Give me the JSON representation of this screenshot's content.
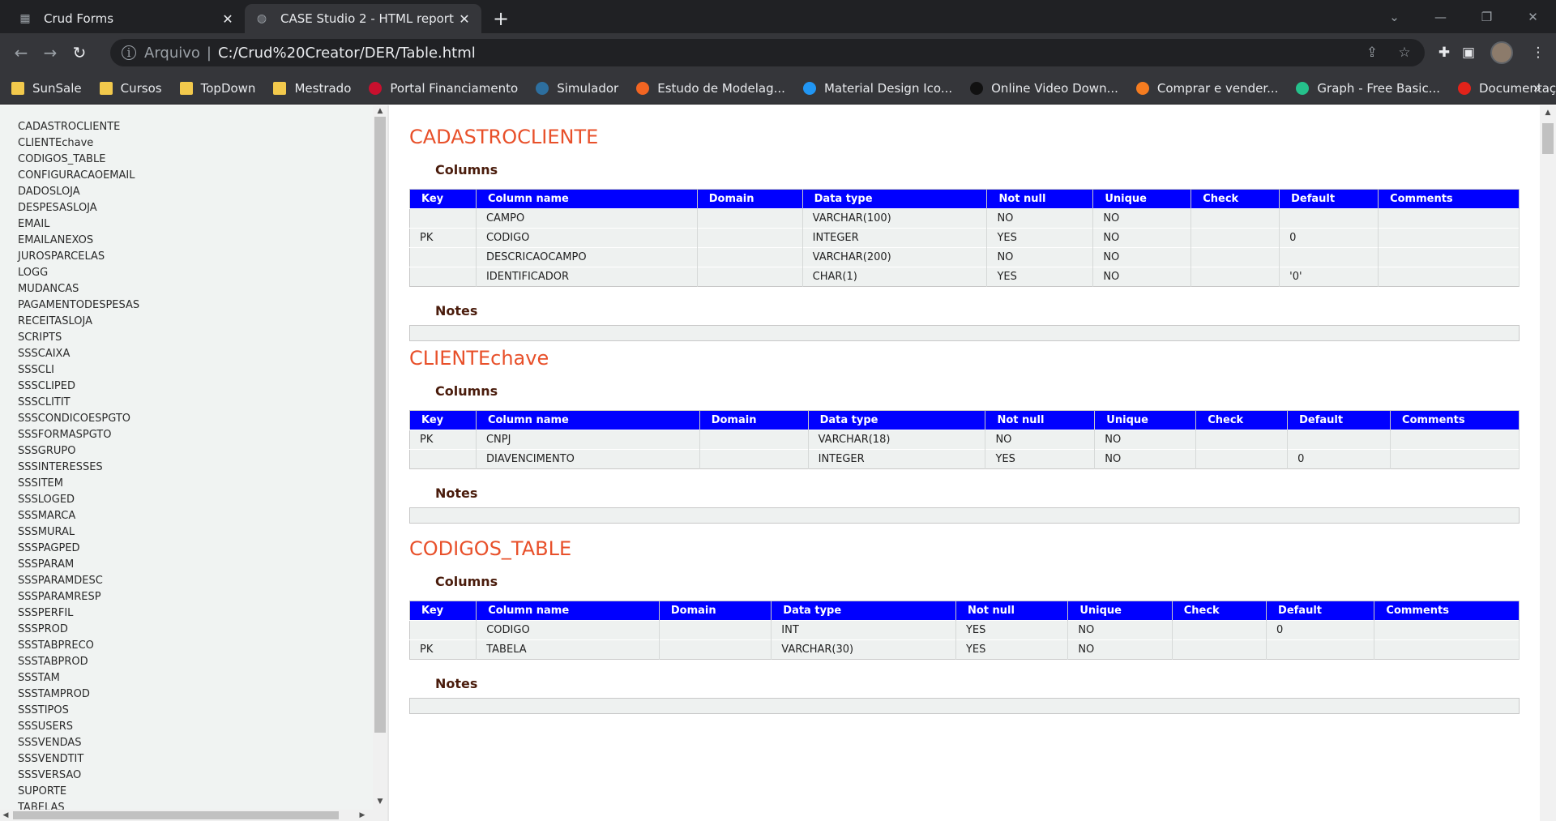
{
  "browser": {
    "tabs": [
      {
        "label": "Crud Forms",
        "icon": "page-icon",
        "active": false
      },
      {
        "label": "CASE Studio 2 - HTML report",
        "icon": "globe-icon",
        "active": true
      }
    ],
    "address": {
      "scheme": "Arquivo",
      "separator": "|",
      "url": "C:/Crud%20Creator/DER/Table.html"
    },
    "bookmarks": [
      {
        "label": "SunSale",
        "icon": "folder-icon",
        "color": "#f2c94c"
      },
      {
        "label": "Cursos",
        "icon": "folder-icon",
        "color": "#f2c94c"
      },
      {
        "label": "TopDown",
        "icon": "folder-icon",
        "color": "#f2c94c"
      },
      {
        "label": "Mestrado",
        "icon": "folder-icon",
        "color": "#f2c94c"
      },
      {
        "label": "Portal Financiamento",
        "icon": "bank-icon",
        "color": "#c8102e"
      },
      {
        "label": "Simulador",
        "icon": "simulator-icon",
        "color": "#2d6f9f"
      },
      {
        "label": "Estudo de Modelag...",
        "icon": "study-icon",
        "color": "#f26522"
      },
      {
        "label": "Material Design Ico...",
        "icon": "material-icon",
        "color": "#2196f3"
      },
      {
        "label": "Online Video Down...",
        "icon": "cloud-icon",
        "color": "#111111"
      },
      {
        "label": "Comprar e vender...",
        "icon": "shop-icon",
        "color": "#f57c20"
      },
      {
        "label": "Graph - Free Basic...",
        "icon": "graph-icon",
        "color": "#25c18b"
      },
      {
        "label": "Documentação Ora...",
        "icon": "oracle-icon",
        "color": "#e2231a"
      }
    ],
    "bookmarks_more": "»"
  },
  "sidebar": {
    "items": [
      "CADASTROCLIENTE",
      "CLIENTEchave",
      "CODIGOS_TABLE",
      "CONFIGURACAOEMAIL",
      "DADOSLOJA",
      "DESPESASLOJA",
      "EMAIL",
      "EMAILANEXOS",
      "JUROSPARCELAS",
      "LOGG",
      "MUDANCAS",
      "PAGAMENTODESPESAS",
      "RECEITASLOJA",
      "SCRIPTS",
      "SSSCAIXA",
      "SSSCLI",
      "SSSCLIPED",
      "SSSCLITIT",
      "SSSCONDICOESPGTO",
      "SSSFORMASPGTO",
      "SSSGRUPO",
      "SSSINTERESSES",
      "SSSITEM",
      "SSSLOGED",
      "SSSMARCA",
      "SSSMURAL",
      "SSSPAGPED",
      "SSSPARAM",
      "SSSPARAMDESC",
      "SSSPARAMRESP",
      "SSSPERFIL",
      "SSSPROD",
      "SSSTABPRECO",
      "SSSTABPROD",
      "SSSTAM",
      "SSSTAMPROD",
      "SSSTIPOS",
      "SSSUSERS",
      "SSSVENDAS",
      "SSSVENDTIT",
      "SSSVERSAO",
      "SUPORTE",
      "TABELAS"
    ]
  },
  "labels": {
    "columns": "Columns",
    "notes": "Notes"
  },
  "header_cols": [
    "Key",
    "Column name",
    "Domain",
    "Data type",
    "Not null",
    "Unique",
    "Check",
    "Default",
    "Comments"
  ],
  "tables": [
    {
      "name": "CADASTROCLIENTE",
      "rows": [
        [
          "",
          "CAMPO",
          "",
          "VARCHAR(100)",
          "NO",
          "NO",
          "",
          "",
          ""
        ],
        [
          "PK",
          "CODIGO",
          "",
          "INTEGER",
          "YES",
          "NO",
          "",
          "0",
          ""
        ],
        [
          "",
          "DESCRICAOCAMPO",
          "",
          "VARCHAR(200)",
          "NO",
          "NO",
          "",
          "",
          ""
        ],
        [
          "",
          "IDENTIFICADOR",
          "",
          "CHAR(1)",
          "YES",
          "NO",
          "",
          "'0'",
          ""
        ]
      ]
    },
    {
      "name": "CLIENTEchave",
      "rows": [
        [
          "PK",
          "CNPJ",
          "",
          "VARCHAR(18)",
          "NO",
          "NO",
          "",
          "",
          ""
        ],
        [
          "",
          "DIAVENCIMENTO",
          "",
          "INTEGER",
          "YES",
          "NO",
          "",
          "0",
          ""
        ]
      ]
    },
    {
      "name": "CODIGOS_TABLE",
      "rows": [
        [
          "",
          "CODIGO",
          "",
          "INT",
          "YES",
          "NO",
          "",
          "0",
          ""
        ],
        [
          "PK",
          "TABELA",
          "",
          "VARCHAR(30)",
          "YES",
          "NO",
          "",
          "",
          ""
        ]
      ]
    }
  ]
}
